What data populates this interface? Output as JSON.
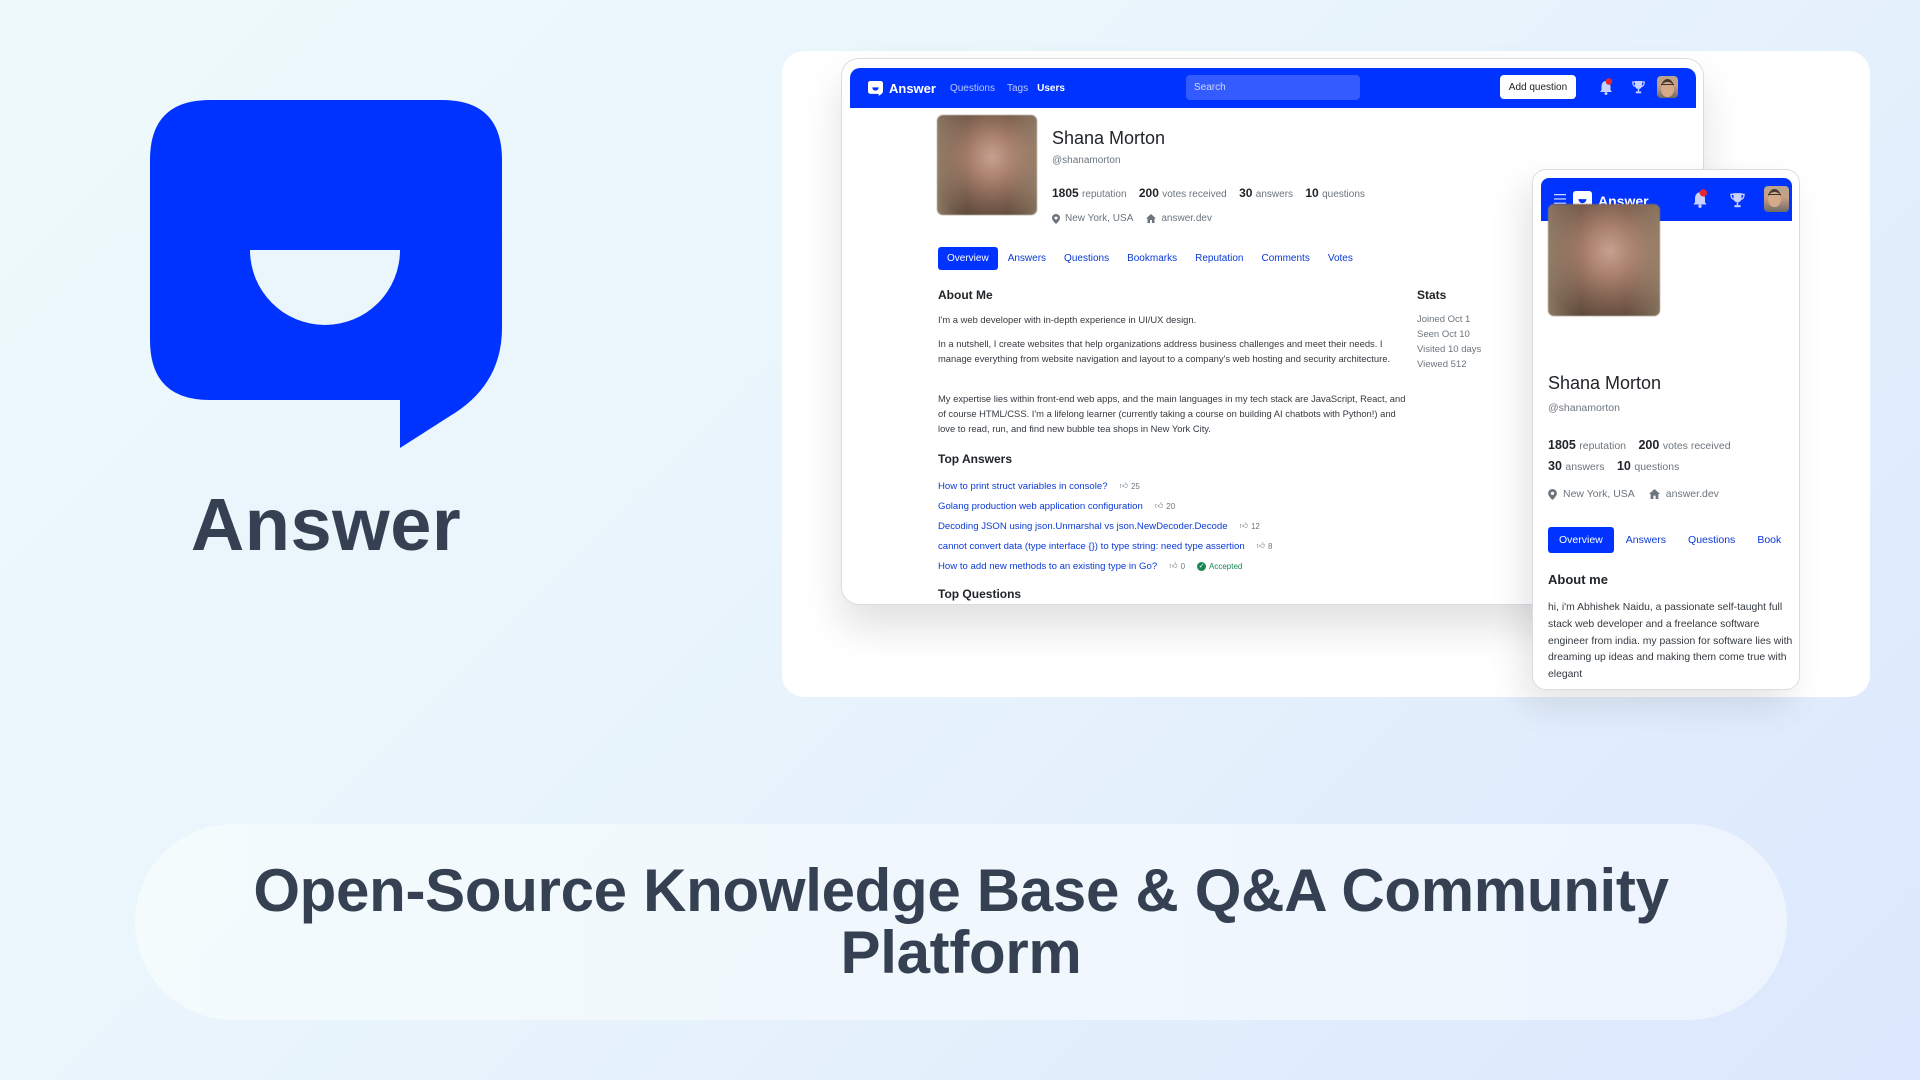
{
  "brand": {
    "name": "Answer",
    "tagline": "Open-Source Knowledge Base & Q&A Community Platform",
    "accent_color": "#0033ff",
    "text_color": "#354152"
  },
  "desktop": {
    "nav": {
      "logo_text": "Answer",
      "links": [
        "Questions",
        "Tags",
        "Users"
      ],
      "active_link": "Users",
      "search_placeholder": "Search",
      "add_question_label": "Add question",
      "icons": [
        "bell-icon",
        "trophy-icon",
        "avatar"
      ]
    },
    "profile": {
      "name": "Shana Morton",
      "handle": "@shanamorton",
      "stats": [
        {
          "value": "1805",
          "label": "reputation"
        },
        {
          "value": "200",
          "label": "votes received"
        },
        {
          "value": "30",
          "label": "answers"
        },
        {
          "value": "10",
          "label": "questions"
        }
      ],
      "location": "New York, USA",
      "website": "answer.dev"
    },
    "tabs": [
      "Overview",
      "Answers",
      "Questions",
      "Bookmarks",
      "Reputation",
      "Comments",
      "Votes"
    ],
    "active_tab": "Overview",
    "about": {
      "title": "About Me",
      "paragraphs": [
        "I'm a web developer with in-depth experience in UI/UX design.",
        "In a nutshell, I create websites that help organizations address business challenges and meet their needs. I manage everything from website navigation and layout to a company's web hosting and security architecture.",
        "My expertise lies within front-end web apps, and the main languages in my tech stack are JavaScript, React, and of course HTML/CSS. I'm a lifelong learner (currently taking a course on building AI chatbots with Python!) and love to read, run, and find new bubble tea shops in New York City."
      ]
    },
    "stats_panel": {
      "title": "Stats",
      "items": [
        "Joined Oct 1",
        "Seen Oct 10",
        "Visited 10 days",
        "Viewed 512"
      ]
    },
    "top_answers": {
      "title": "Top Answers",
      "items": [
        {
          "title": "How to print struct variables in console?",
          "votes": "25"
        },
        {
          "title": "Golang production web application configuration",
          "votes": "20"
        },
        {
          "title": "Decoding JSON using json.Unmarshal vs json.NewDecoder.Decode",
          "votes": "12"
        },
        {
          "title": "cannot convert data (type interface {}) to type string: need type assertion",
          "votes": "8"
        },
        {
          "title": "How to add new methods to an existing type in Go?",
          "votes": "0",
          "badge": "Accepted"
        }
      ]
    },
    "top_questions": {
      "title": "Top Questions"
    }
  },
  "mobile": {
    "nav": {
      "logo_text": "Answer"
    },
    "profile": {
      "name": "Shana Morton",
      "handle": "@shanamorton",
      "stats_row1": [
        {
          "value": "1805",
          "label": "reputation"
        },
        {
          "value": "200",
          "label": "votes received"
        }
      ],
      "stats_row2": [
        {
          "value": "30",
          "label": "answers"
        },
        {
          "value": "10",
          "label": "questions"
        }
      ],
      "location": "New York, USA",
      "website": "answer.dev"
    },
    "tabs": [
      "Overview",
      "Answers",
      "Questions",
      "Book"
    ],
    "about": {
      "title": "About me",
      "text": "hi, i'm Abhishek Naidu, a passionate self-taught full stack web developer and a freelance software engineer from india. my passion for software lies with dreaming up ideas and making them come true with elegant"
    }
  }
}
